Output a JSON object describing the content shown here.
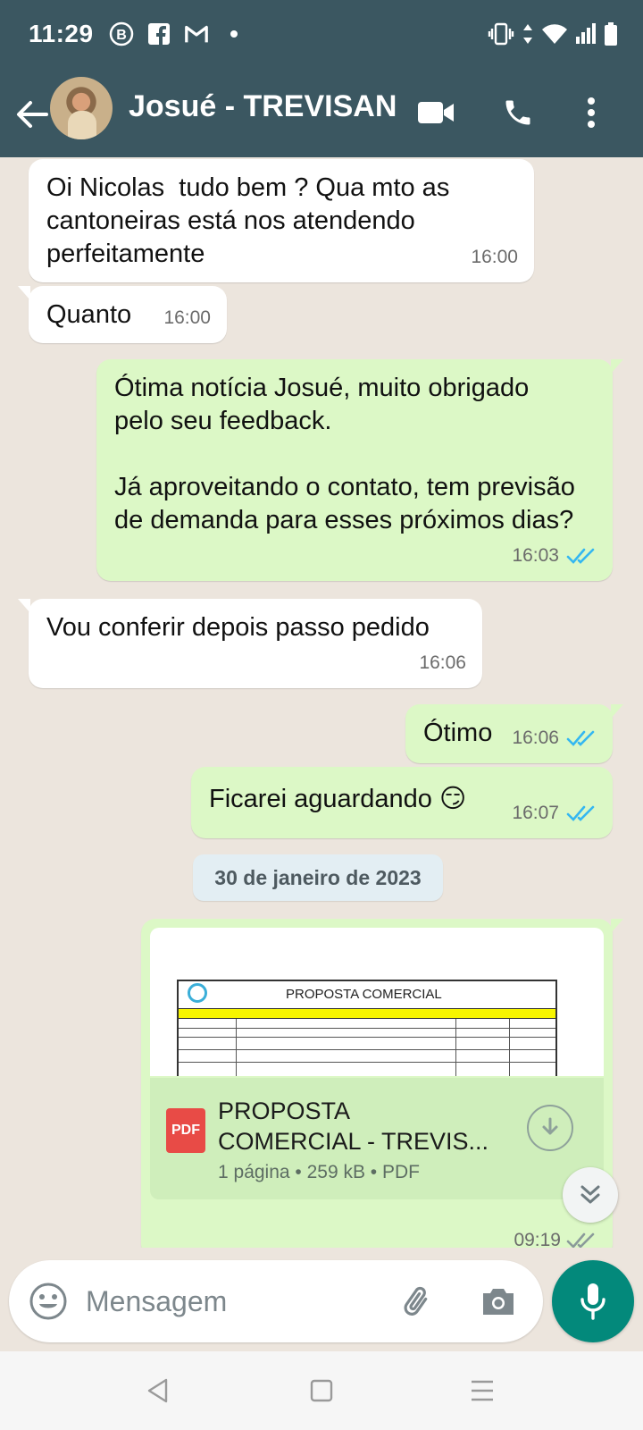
{
  "status_bar": {
    "time": "11:29",
    "left_icons": [
      "b-circle-icon",
      "facebook-icon",
      "gmail-icon",
      "dot-icon"
    ],
    "right_icons": [
      "vibrate-icon",
      "data-arrows-icon",
      "wifi-icon",
      "signal-icon",
      "battery-icon"
    ]
  },
  "app_bar": {
    "contact_name": "Josué - TREVISAN",
    "icons": [
      "back-arrow-icon",
      "video-call-icon",
      "phone-icon",
      "more-vert-icon"
    ],
    "color": "#3b5761"
  },
  "messages": [
    {
      "dir": "in",
      "text": "Oi Nicolas  tudo bem ? Qua mto as cantoneiras está nos atendendo perfeitamente",
      "time": "16:00"
    },
    {
      "dir": "in",
      "text": "Quanto",
      "time": "16:00"
    },
    {
      "dir": "out",
      "text": "Ótima notícia Josué, muito obrigado pelo seu feedback.\n\nJá aproveitando o contato, tem previsão de demanda para esses próximos dias?",
      "time": "16:03",
      "read": true
    },
    {
      "dir": "in",
      "text": "Vou conferir depois passo pedido",
      "time": "16:06"
    },
    {
      "dir": "out",
      "text": "Ótimo",
      "time": "16:06",
      "read": true
    },
    {
      "dir": "out",
      "text": "Ficarei aguardando 😏",
      "time": "16:07",
      "read": true
    }
  ],
  "date_chip": "30 de janeiro de 2023",
  "document": {
    "preview_title": "PROPOSTA COMERCIAL",
    "file_name": "PROPOSTA COMERCIAL - TREVIS...",
    "file_name_line1": "PROPOSTA",
    "file_name_line2": "COMERCIAL - TREVIS...",
    "badge": "PDF",
    "info": "1 página • 259 kB • PDF",
    "time": "09:19"
  },
  "input": {
    "placeholder": "Mensagem"
  },
  "colors": {
    "outgoing_bubble": "#dcf8c6",
    "incoming_bubble": "#ffffff",
    "chat_background": "#ece5dd",
    "read_ticks": "#34b7f1",
    "mic_button": "#03897b"
  }
}
